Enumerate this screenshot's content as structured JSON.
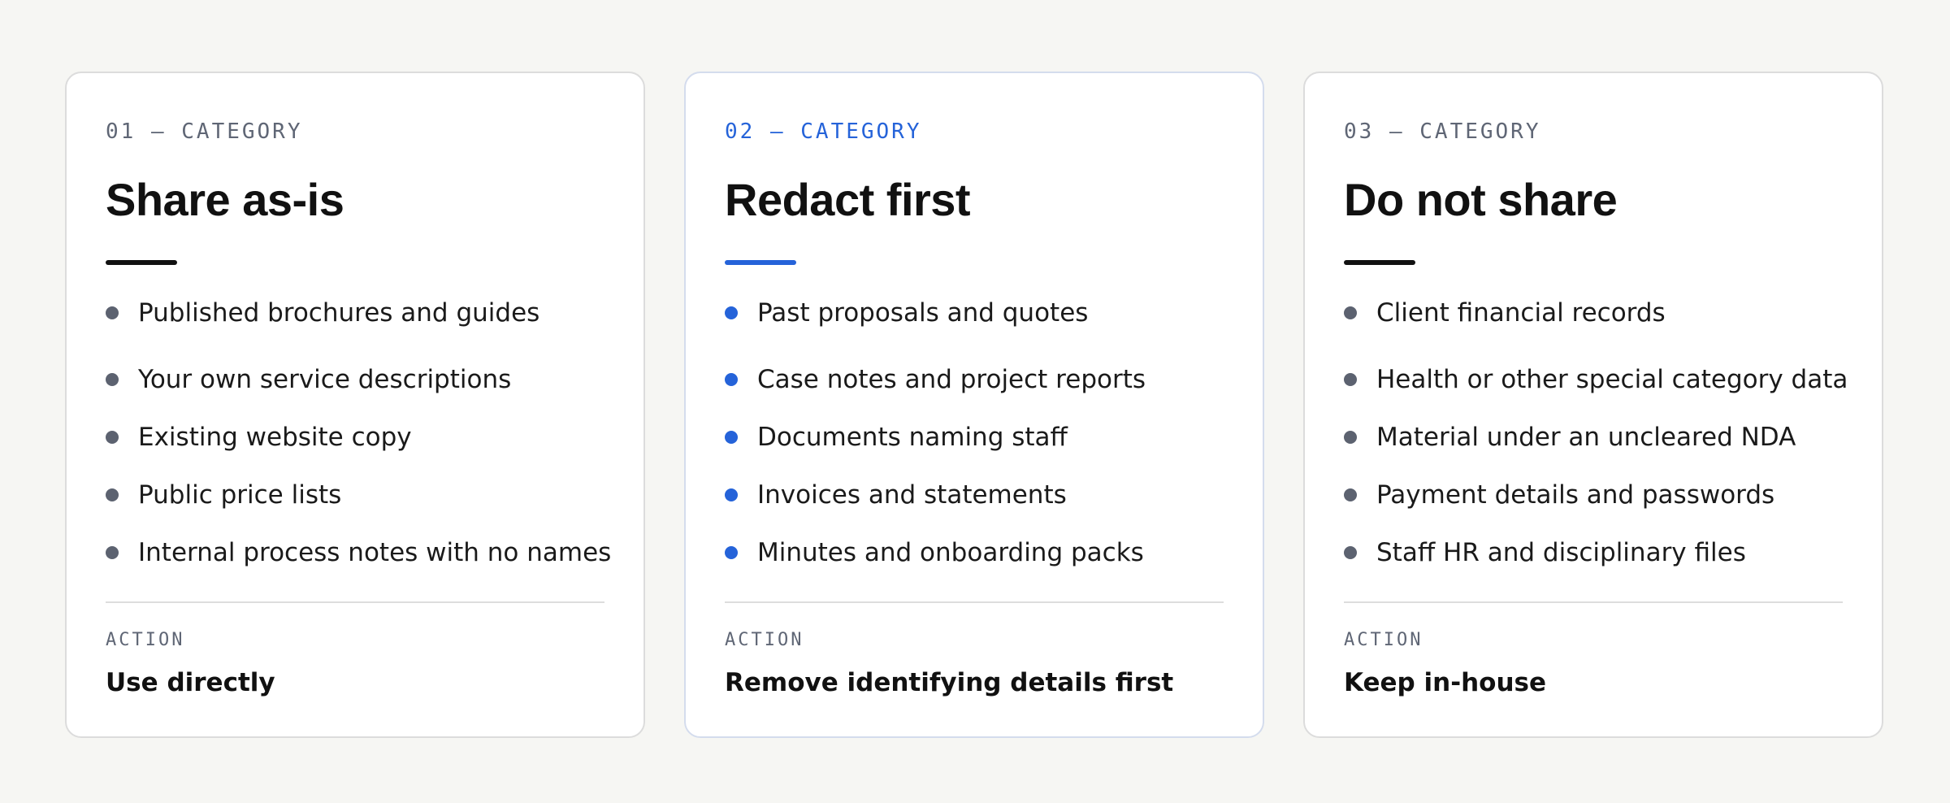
{
  "cards": [
    {
      "eyebrow": "01 — CATEGORY",
      "title": "Share as-is",
      "items": [
        "Published brochures and guides",
        "Your own service descriptions",
        "Existing website copy",
        "Public price lists",
        "Internal process notes with no names"
      ],
      "action_label": "ACTION",
      "action_value": "Use directly"
    },
    {
      "eyebrow": "02 — CATEGORY",
      "title": "Redact first",
      "items": [
        "Past proposals and quotes",
        "Case notes and project reports",
        "Documents naming staff",
        "Invoices and statements",
        "Minutes and onboarding packs"
      ],
      "action_label": "ACTION",
      "action_value": "Remove identifying details first"
    },
    {
      "eyebrow": "03 — CATEGORY",
      "title": "Do not share",
      "items": [
        "Client financial records",
        "Health or other special category data",
        "Material under an uncleared NDA",
        "Payment details and passwords",
        "Staff HR and disciplinary files"
      ],
      "action_label": "ACTION",
      "action_value": "Keep in-house"
    }
  ],
  "colors": {
    "accent": "#2563d9",
    "background": "#f6f6f3",
    "card": "#ffffff",
    "muted": "#5f6675",
    "text": "#111111"
  }
}
